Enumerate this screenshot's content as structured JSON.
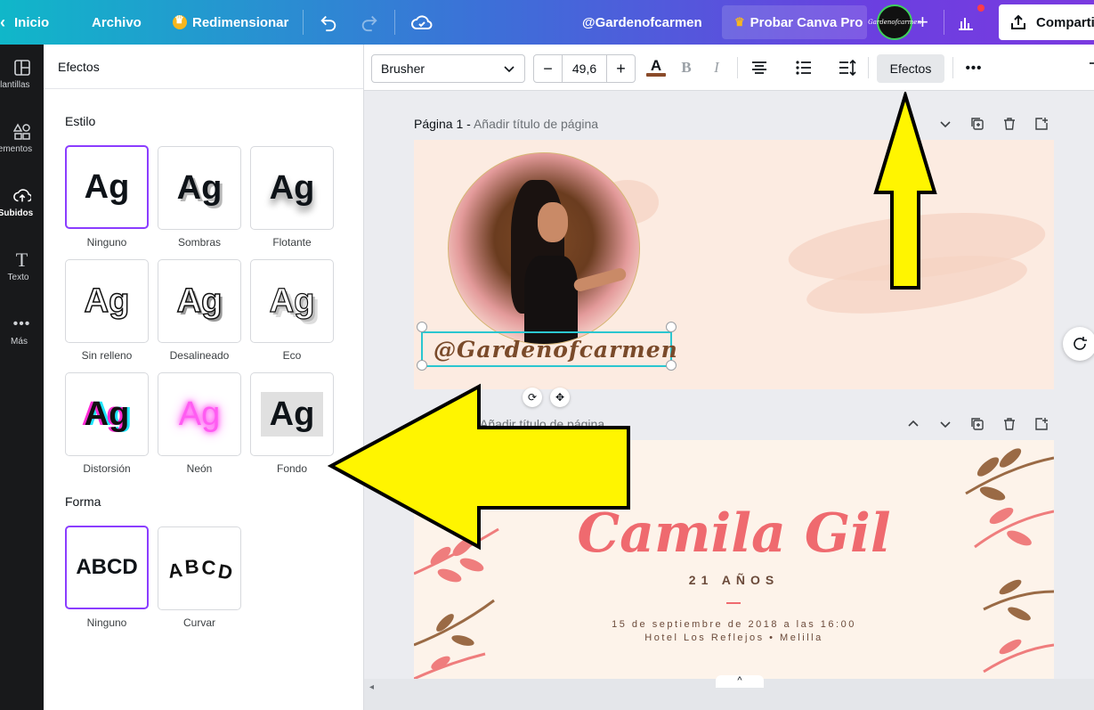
{
  "topbar": {
    "home": "Inicio",
    "file": "Archivo",
    "resize": "Redimensionar",
    "design_name": "@Gardenofcarmen",
    "try_pro": "Probar Canva Pro",
    "share": "Compartir",
    "avatar_text": "Gardenofcarmen"
  },
  "rail": {
    "items": [
      {
        "label": "Plantillas",
        "icon": "templates-icon"
      },
      {
        "label": "Elementos",
        "icon": "elements-icon"
      },
      {
        "label": "Subidos",
        "icon": "uploads-icon"
      },
      {
        "label": "Texto",
        "icon": "text-icon"
      },
      {
        "label": "Más",
        "icon": "more-icon"
      }
    ]
  },
  "panel": {
    "title": "Efectos",
    "style_title": "Estilo",
    "style_sample": "Ag",
    "styles": [
      "Ninguno",
      "Sombras",
      "Flotante",
      "Sin relleno",
      "Desalineado",
      "Eco",
      "Distorsión",
      "Neón",
      "Fondo"
    ],
    "shape_title": "Forma",
    "shape_sample": "ABCD",
    "shapes": [
      "Ninguno",
      "Curvar"
    ]
  },
  "toolbar": {
    "font": "Brusher",
    "font_size": "49,6",
    "effects": "Efectos",
    "text_color": "#8a4b2a"
  },
  "canvas": {
    "page1_label": "Página 1 -",
    "page1_title_placeholder": "Añadir título de página",
    "page2_title_placeholder": "Añadir título de página",
    "page1_text": "@Gardenofcarmen",
    "page2": {
      "name": "Camila Gil",
      "age": "21 AÑOS",
      "date": "15 de septiembre de 2018 a las 16:00",
      "place": "Hotel Los Reflejos • Melilla"
    }
  },
  "colors": {
    "accent": "#8b3dff",
    "selection": "#2bc6d0",
    "arrow": "#fff500",
    "coral": "#ef6a6f"
  }
}
